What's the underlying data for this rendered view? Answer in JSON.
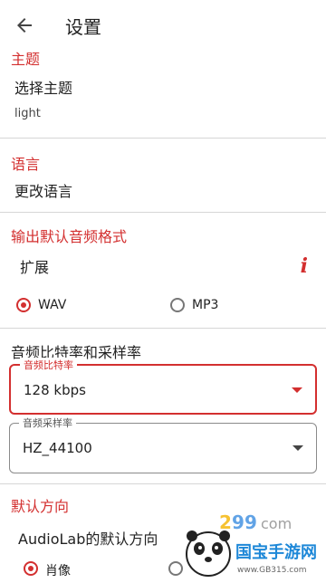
{
  "appbar": {
    "title": "设置"
  },
  "theme": {
    "section_title": "主题",
    "choose_label": "选择主题",
    "current_value": "light"
  },
  "language": {
    "section_title": "语言",
    "change_label": "更改语言"
  },
  "output": {
    "section_title": "输出默认音频格式",
    "extension_label": "扩展",
    "info_icon": "i",
    "options": [
      "WAV",
      "MP3"
    ],
    "selected": "WAV"
  },
  "bitrate": {
    "heading": "音频比特率和采样率",
    "bitrate_field": {
      "label": "音频比特率",
      "value": "128 kbps"
    },
    "samplerate_field": {
      "label": "音频采样率",
      "value": "HZ_44100"
    }
  },
  "orientation": {
    "section_title": "默认方向",
    "default_label": "AudioLab的默认方向",
    "options": [
      "肖像"
    ],
    "selected": "肖像"
  },
  "watermark": {
    "site_text": "国宝手游网",
    "url_text": "www.GB315.com",
    "brand_text": "com"
  },
  "colors": {
    "accent": "#d32f2f",
    "divider": "#d6d6d6"
  }
}
